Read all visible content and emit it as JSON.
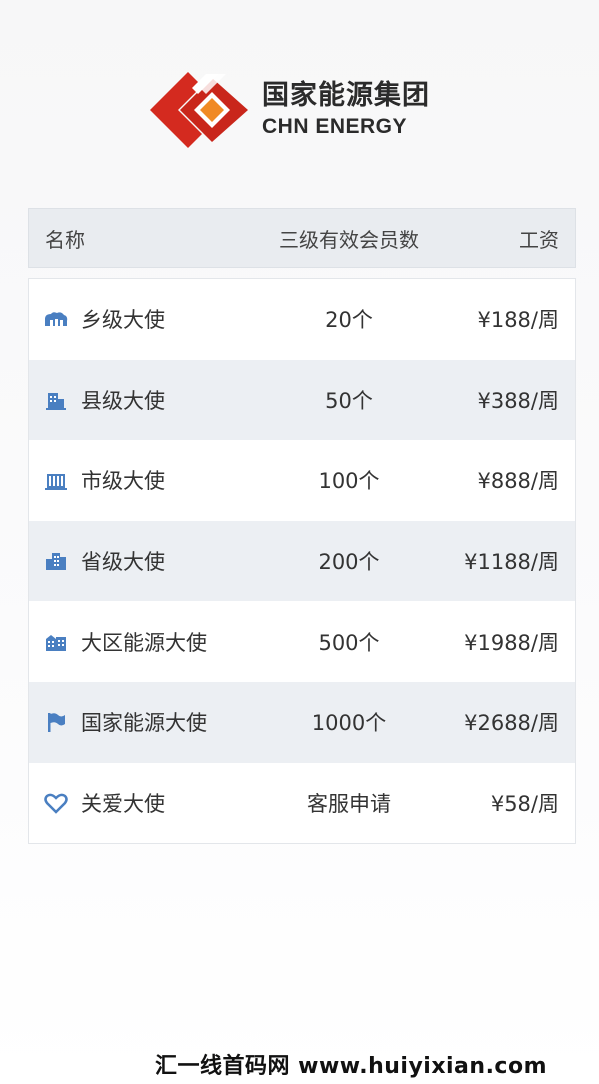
{
  "brand": {
    "name_cn": "国家能源集团",
    "name_en": "CHN ENERGY",
    "colors": {
      "red": "#d42a1f",
      "orange": "#f08a24",
      "text": "#2b2b2b"
    }
  },
  "table": {
    "headers": {
      "name": "名称",
      "count": "三级有效会员数",
      "pay": "工资"
    },
    "rows": [
      {
        "icon": "town-icon",
        "name": "乡级大使",
        "count": "20个",
        "pay": "¥188/周"
      },
      {
        "icon": "county-building-icon",
        "name": "县级大使",
        "count": "50个",
        "pay": "¥388/周"
      },
      {
        "icon": "city-building-icon",
        "name": "市级大使",
        "count": "100个",
        "pay": "¥888/周"
      },
      {
        "icon": "province-buildings-icon",
        "name": "省级大使",
        "count": "200个",
        "pay": "¥1188/周"
      },
      {
        "icon": "region-buildings-icon",
        "name": "大区能源大使",
        "count": "500个",
        "pay": "¥1988/周"
      },
      {
        "icon": "flag-icon",
        "name": "国家能源大使",
        "count": "1000个",
        "pay": "¥2688/周"
      },
      {
        "icon": "heart-icon",
        "name": "关爱大使",
        "count": "客服申请",
        "pay": "¥58/周"
      }
    ],
    "colors": {
      "header_bg": "#e9ecf0",
      "alt_row_bg": "#eceff3",
      "icon": "#4a7fc1"
    }
  },
  "watermark": {
    "text": "汇一线首码网 www.huiyixian.com"
  }
}
